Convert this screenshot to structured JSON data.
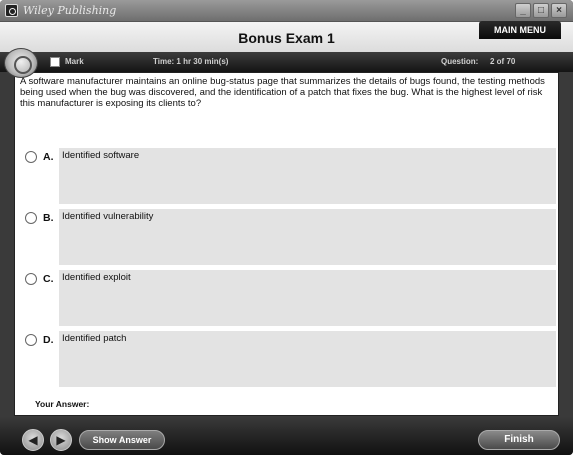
{
  "window": {
    "title": "Wiley Publishing",
    "controls": {
      "minimize": "_",
      "maximize": "□",
      "close": "×"
    }
  },
  "header": {
    "exam_title": "Bonus Exam 1",
    "main_menu_label": "MAIN MENU"
  },
  "status": {
    "mark_label": "Mark",
    "time_text": "Time:  1 hr  30 min(s)",
    "question_label": "Question:",
    "question_count": "2 of 70"
  },
  "question": {
    "text": "A software manufacturer maintains an online bug-status page that summarizes the details of bugs found, the testing methods being used when the bug was discovered, and the identification of a patch that fixes the bug. What is the highest level of risk this manufacturer is exposing its clients to?",
    "options": [
      {
        "letter": "A.",
        "text": "Identified software"
      },
      {
        "letter": "B.",
        "text": "Identified vulnerability"
      },
      {
        "letter": "C.",
        "text": "Identified exploit"
      },
      {
        "letter": "D.",
        "text": "Identified patch"
      }
    ]
  },
  "your_answer_label": "Your Answer:",
  "footer": {
    "prev_icon": "arrow-left-icon",
    "next_icon": "arrow-right-icon",
    "show_answer_label": "Show Answer",
    "finish_label": "Finish"
  }
}
